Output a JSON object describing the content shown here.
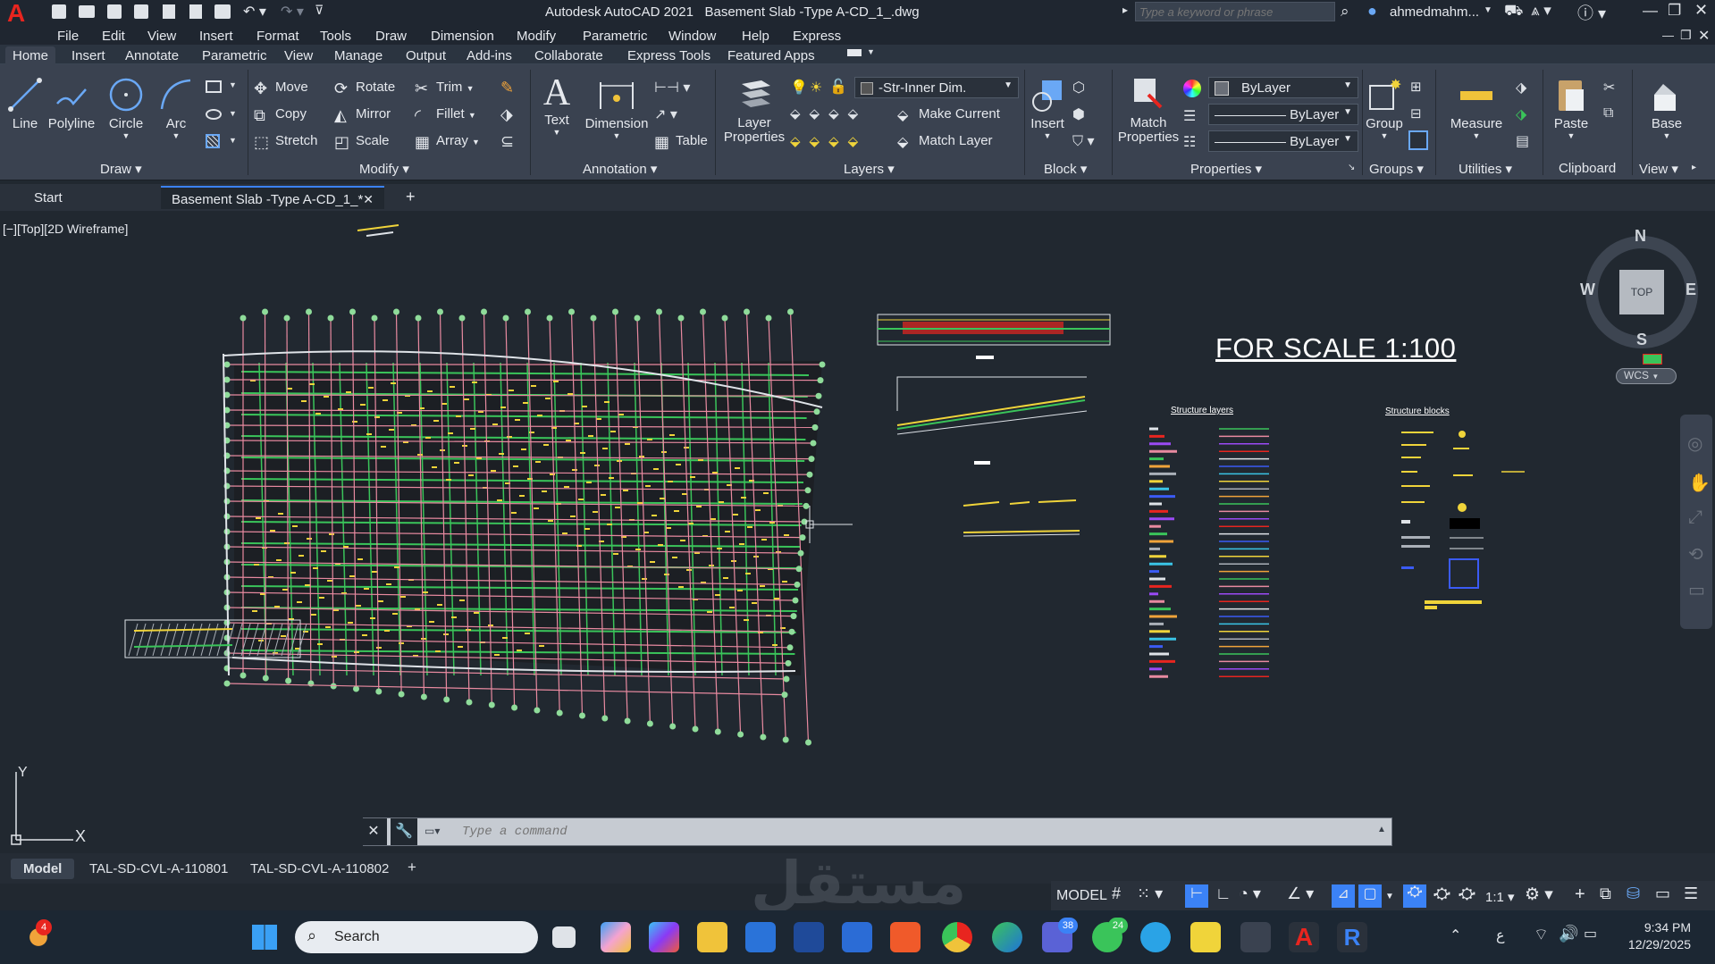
{
  "app": {
    "title": "Autodesk AutoCAD 2021",
    "file": "Basement Slab -Type A-CD_1_.dwg",
    "search_placeholder": "Type a keyword or phrase",
    "user": "ahmedmahm...",
    "logo": "A"
  },
  "menu": [
    "File",
    "Edit",
    "View",
    "Insert",
    "Format",
    "Tools",
    "Draw",
    "Dimension",
    "Modify",
    "Parametric",
    "Window",
    "Help",
    "Express"
  ],
  "ribbon_tabs": [
    "Home",
    "Insert",
    "Annotate",
    "Parametric",
    "View",
    "Manage",
    "Output",
    "Add-ins",
    "Collaborate",
    "Express Tools",
    "Featured Apps"
  ],
  "draw": {
    "line": "Line",
    "polyline": "Polyline",
    "circle": "Circle",
    "arc": "Arc",
    "label": "Draw"
  },
  "modify": {
    "move": "Move",
    "rotate": "Rotate",
    "trim": "Trim",
    "copy": "Copy",
    "mirror": "Mirror",
    "fillet": "Fillet",
    "stretch": "Stretch",
    "scale": "Scale",
    "array": "Array",
    "label": "Modify"
  },
  "annotation": {
    "text": "Text",
    "dimension": "Dimension",
    "table": "Table",
    "label": "Annotation"
  },
  "layers": {
    "properties": "Layer Properties",
    "current": "-Str-Inner Dim.",
    "make_current": "Make Current",
    "match_layer": "Match Layer",
    "label": "Layers"
  },
  "block": {
    "insert": "Insert",
    "label": "Block"
  },
  "properties": {
    "match": "Match Properties",
    "color": "ByLayer",
    "linetype": "ByLayer",
    "lineweight": "ByLayer",
    "label": "Properties"
  },
  "groups": {
    "group": "Group",
    "label": "Groups"
  },
  "utilities": {
    "measure": "Measure",
    "label": "Utilities"
  },
  "clipboard": {
    "paste": "Paste",
    "label": "Clipboard"
  },
  "view": {
    "base": "Base",
    "label": "View"
  },
  "doctabs": {
    "start": "Start",
    "file": "Basement Slab -Type A-CD_1_*"
  },
  "viewport": {
    "label": "[−][Top][2D Wireframe]"
  },
  "viewcube": {
    "n": "N",
    "s": "S",
    "e": "E",
    "w": "W",
    "top": "TOP",
    "wcs": "WCS"
  },
  "drawing": {
    "scale_title": "FOR SCALE 1:100",
    "structure_layers": "Structure layers",
    "structure_blocks": "Structure blocks"
  },
  "ucs": {
    "x": "X",
    "y": "Y"
  },
  "command": {
    "placeholder": "Type a command"
  },
  "layouts": [
    "Model",
    "TAL-SD-CVL-A-110801",
    "TAL-SD-CVL-A-110802"
  ],
  "status": {
    "model": "MODEL",
    "scale": "1:1"
  },
  "taskbar": {
    "search": "Search",
    "time": "9:34 PM",
    "date": "12/29/2025",
    "lang": "ع",
    "weather_badge": "4",
    "teams_badge": "38",
    "whatsapp_badge": "24"
  },
  "watermark": "مستقل"
}
